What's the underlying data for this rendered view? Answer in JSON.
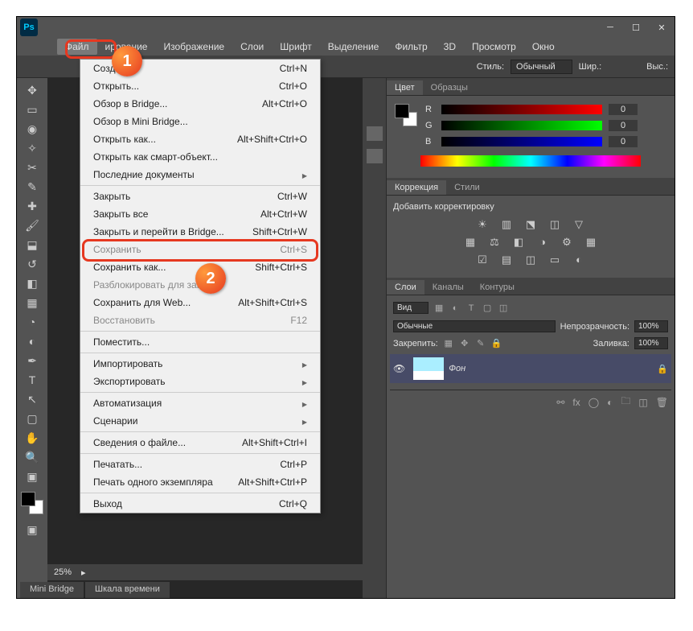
{
  "menubar": [
    "Файл",
    "ирование",
    "Изображение",
    "Слои",
    "Шрифт",
    "Выделение",
    "Фильтр",
    "3D",
    "Просмотр",
    "Окно"
  ],
  "badges": {
    "one": "1",
    "two": "2"
  },
  "optionsbar": {
    "style_label": "Стиль:",
    "style_value": "Обычный",
    "width_label": "Шир.:",
    "height_label": "Выс.:"
  },
  "dropdown": [
    {
      "label": "Создать...",
      "shortcut": "Ctrl+N"
    },
    {
      "label": "Открыть...",
      "shortcut": "Ctrl+O"
    },
    {
      "label": "Обзор в Bridge...",
      "shortcut": "Alt+Ctrl+O"
    },
    {
      "label": "Обзор в Mini Bridge..."
    },
    {
      "label": "Открыть как...",
      "shortcut": "Alt+Shift+Ctrl+O"
    },
    {
      "label": "Открыть как смарт-объект..."
    },
    {
      "label": "Последние документы",
      "submenu": true
    },
    {
      "sep": true
    },
    {
      "label": "Закрыть",
      "shortcut": "Ctrl+W"
    },
    {
      "label": "Закрыть все",
      "shortcut": "Alt+Ctrl+W"
    },
    {
      "label": "Закрыть и перейти в Bridge...",
      "shortcut": "Shift+Ctrl+W"
    },
    {
      "label": "Сохранить",
      "shortcut": "Ctrl+S",
      "disabled": true
    },
    {
      "label": "Сохранить как...",
      "shortcut": "Shift+Ctrl+S",
      "highlighted": true
    },
    {
      "label": "Разблокировать для зап...",
      "disabled": true
    },
    {
      "label": "Сохранить для Web...",
      "shortcut": "Alt+Shift+Ctrl+S"
    },
    {
      "label": "Восстановить",
      "shortcut": "F12",
      "disabled": true
    },
    {
      "sep": true
    },
    {
      "label": "Поместить..."
    },
    {
      "sep": true
    },
    {
      "label": "Импортировать",
      "submenu": true
    },
    {
      "label": "Экспортировать",
      "submenu": true
    },
    {
      "sep": true
    },
    {
      "label": "Автоматизация",
      "submenu": true
    },
    {
      "label": "Сценарии",
      "submenu": true
    },
    {
      "sep": true
    },
    {
      "label": "Сведения о файле...",
      "shortcut": "Alt+Shift+Ctrl+I"
    },
    {
      "sep": true
    },
    {
      "label": "Печатать...",
      "shortcut": "Ctrl+P"
    },
    {
      "label": "Печать одного экземпляра",
      "shortcut": "Alt+Shift+Ctrl+P"
    },
    {
      "sep": true
    },
    {
      "label": "Выход",
      "shortcut": "Ctrl+Q"
    }
  ],
  "panels": {
    "color_tab": "Цвет",
    "swatches_tab": "Образцы",
    "rgb": {
      "r_label": "R",
      "g_label": "G",
      "b_label": "B",
      "r": "0",
      "g": "0",
      "b": "0"
    },
    "correction_tab": "Коррекция",
    "styles_tab": "Стили",
    "adjust_title": "Добавить корректировку",
    "layers_tab": "Слои",
    "channels_tab": "Каналы",
    "paths_tab": "Контуры",
    "kind_label": "Вид",
    "blend_value": "Обычные",
    "opacity_label": "Непрозрачность:",
    "opacity_value": "100%",
    "lock_label": "Закрепить:",
    "fill_label": "Заливка:",
    "fill_value": "100%",
    "layer_name": "Фон"
  },
  "status": {
    "zoom": "25%"
  },
  "bottomtabs": {
    "minibridge": "Mini Bridge",
    "timeline": "Шкала времени"
  },
  "logo": "Ps"
}
